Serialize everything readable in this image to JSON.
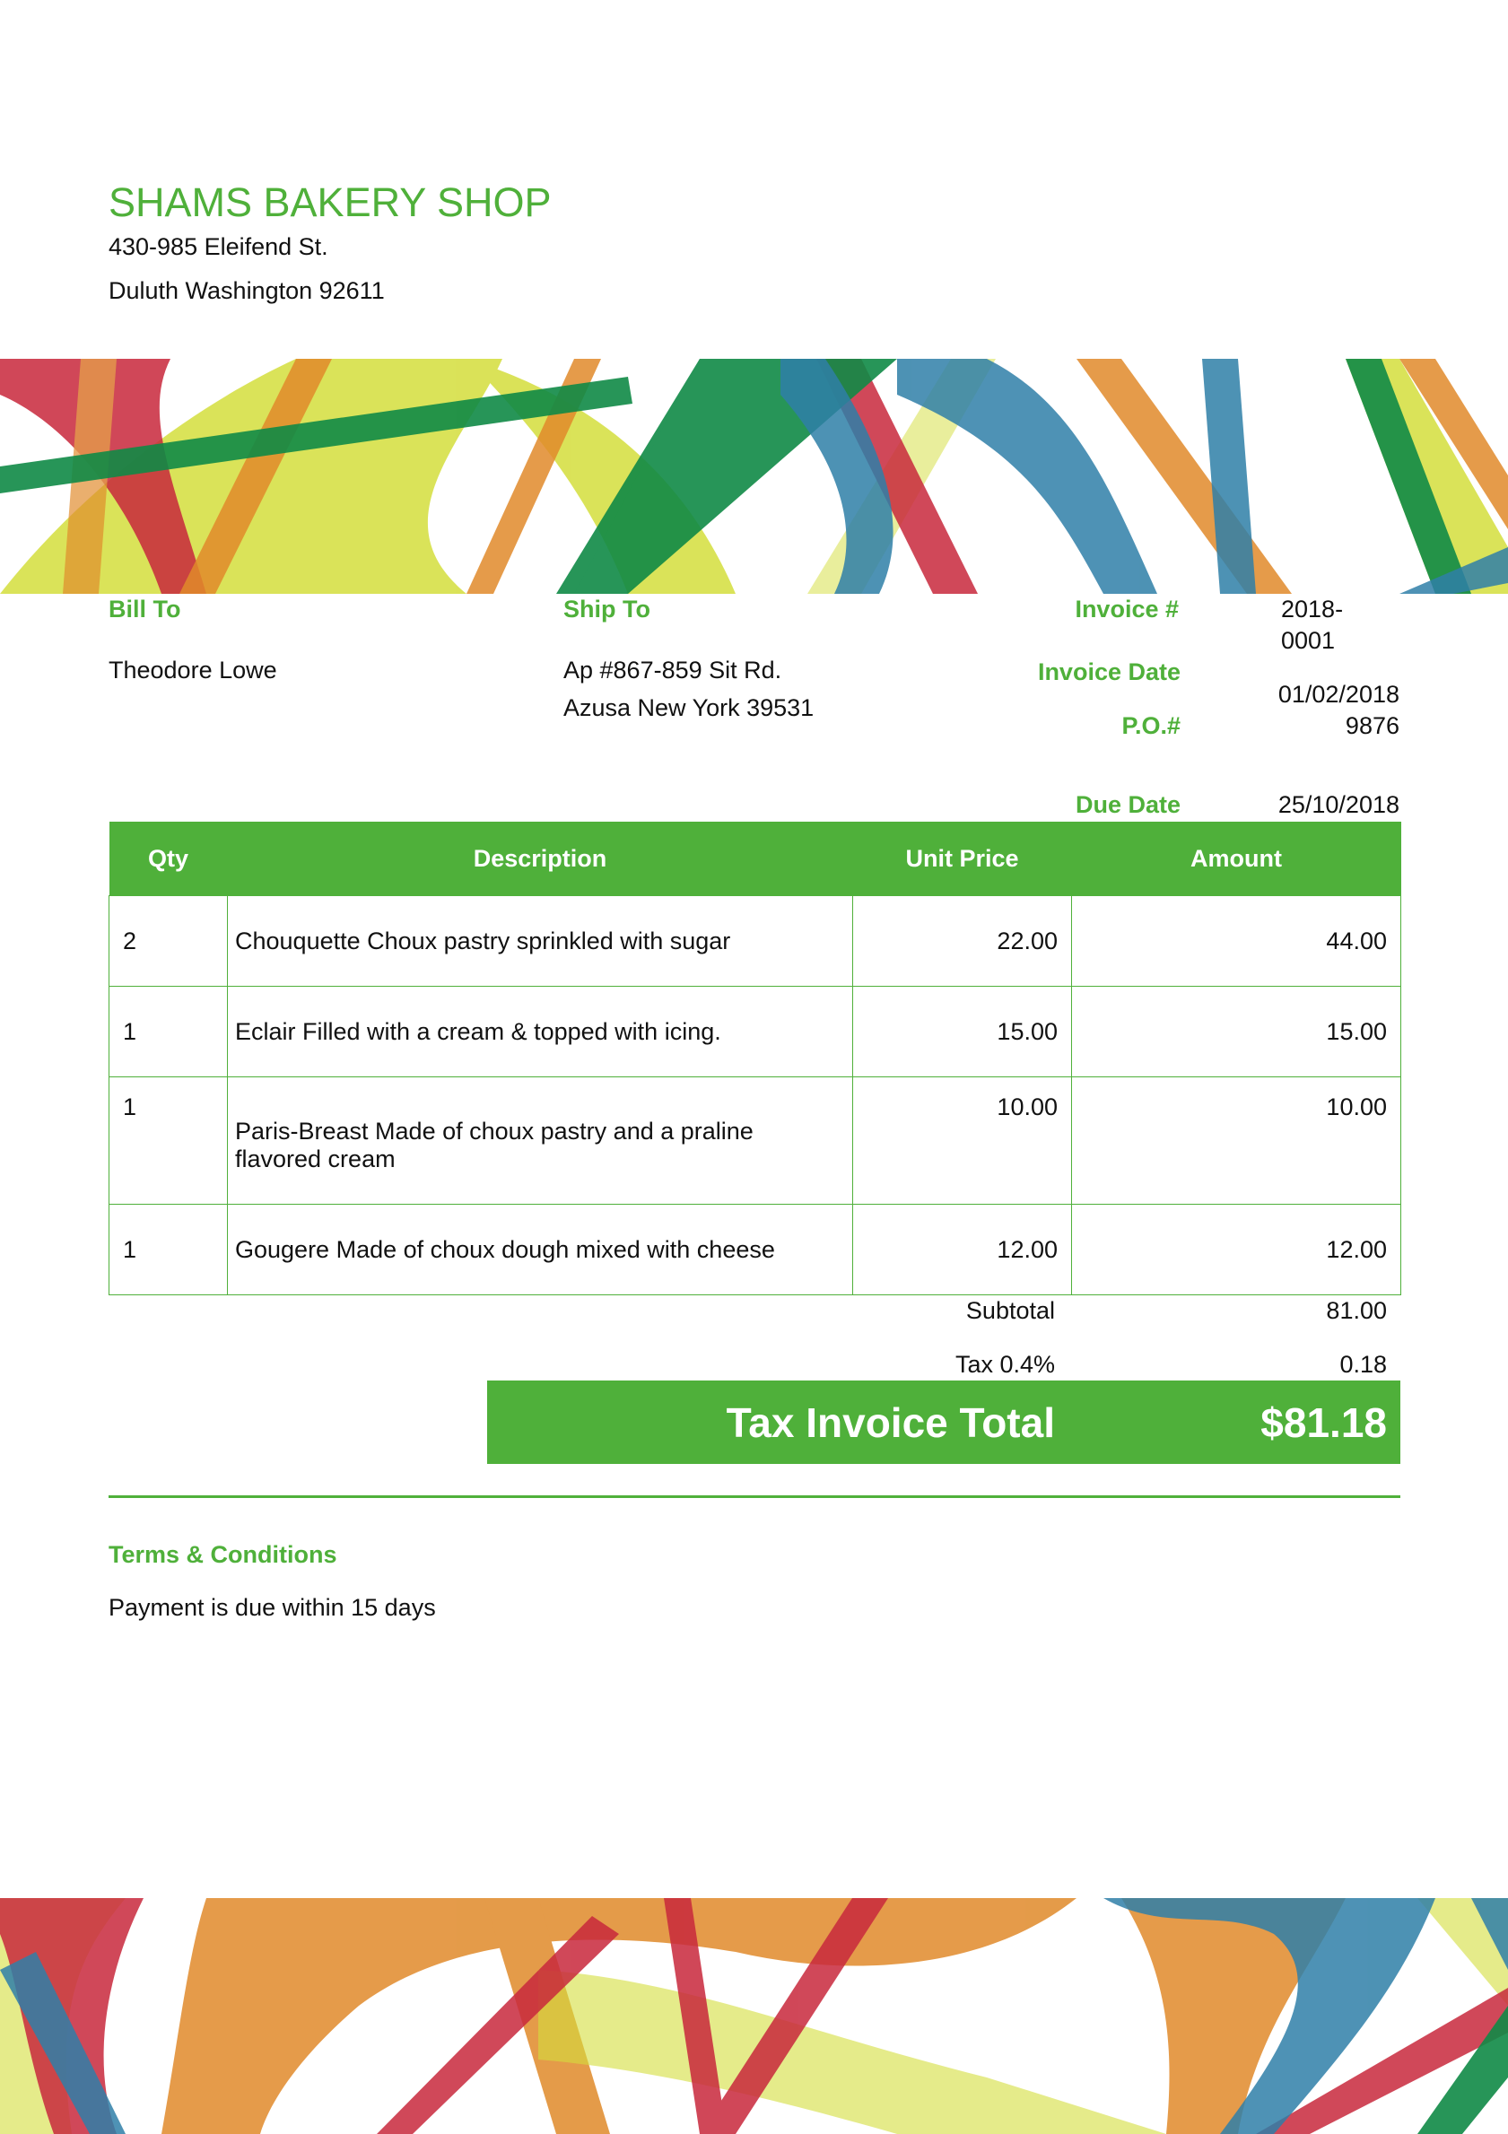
{
  "company": {
    "name": "SHAMS BAKERY SHOP",
    "address_line1": "430-985 Eleifend St.",
    "address_line2": "Duluth Washington 92611"
  },
  "bill_to": {
    "label": "Bill To",
    "name": "Theodore Lowe"
  },
  "ship_to": {
    "label": "Ship To",
    "line1": "Ap #867-859 Sit Rd.",
    "line2": "Azusa New York 39531"
  },
  "meta": {
    "invoice_no_label": "Invoice #",
    "invoice_no_line1": "2018-",
    "invoice_no_line2": "0001",
    "invoice_date_label": "Invoice Date",
    "invoice_date": "01/02/2018",
    "po_label": "P.O.#",
    "po": "9876",
    "due_date_label": "Due Date",
    "due_date": "25/10/2018"
  },
  "table": {
    "headers": [
      "Qty",
      "Description",
      "Unit Price",
      "Amount"
    ],
    "rows": [
      {
        "qty": "2",
        "description": "Chouquette Choux pastry sprinkled with sugar",
        "unit_price": "22.00",
        "amount": "44.00"
      },
      {
        "qty": "1",
        "description": "Eclair Filled with a cream & topped with icing.",
        "unit_price": "15.00",
        "amount": "15.00"
      },
      {
        "qty": "1",
        "description": "Paris-Breast Made of choux pastry and a praline flavored cream",
        "unit_price": "10.00",
        "amount": "10.00"
      },
      {
        "qty": "1",
        "description": "Gougere Made of choux dough mixed with cheese",
        "unit_price": "12.00",
        "amount": "12.00"
      }
    ]
  },
  "totals": {
    "subtotal_label": "Subtotal",
    "subtotal": "81.00",
    "tax_label": "Tax 0.4%",
    "tax": "0.18",
    "total_label": "Tax Invoice Total",
    "total": "$81.18"
  },
  "terms": {
    "label": "Terms & Conditions",
    "text": "Payment is due within 15 days"
  },
  "colors": {
    "accent": "#4fb03a",
    "band_red": "#c8283c",
    "band_orange": "#e08a2a",
    "band_yellow": "#d4de3c",
    "band_green": "#108a46",
    "band_blue": "#2f7fa8"
  }
}
